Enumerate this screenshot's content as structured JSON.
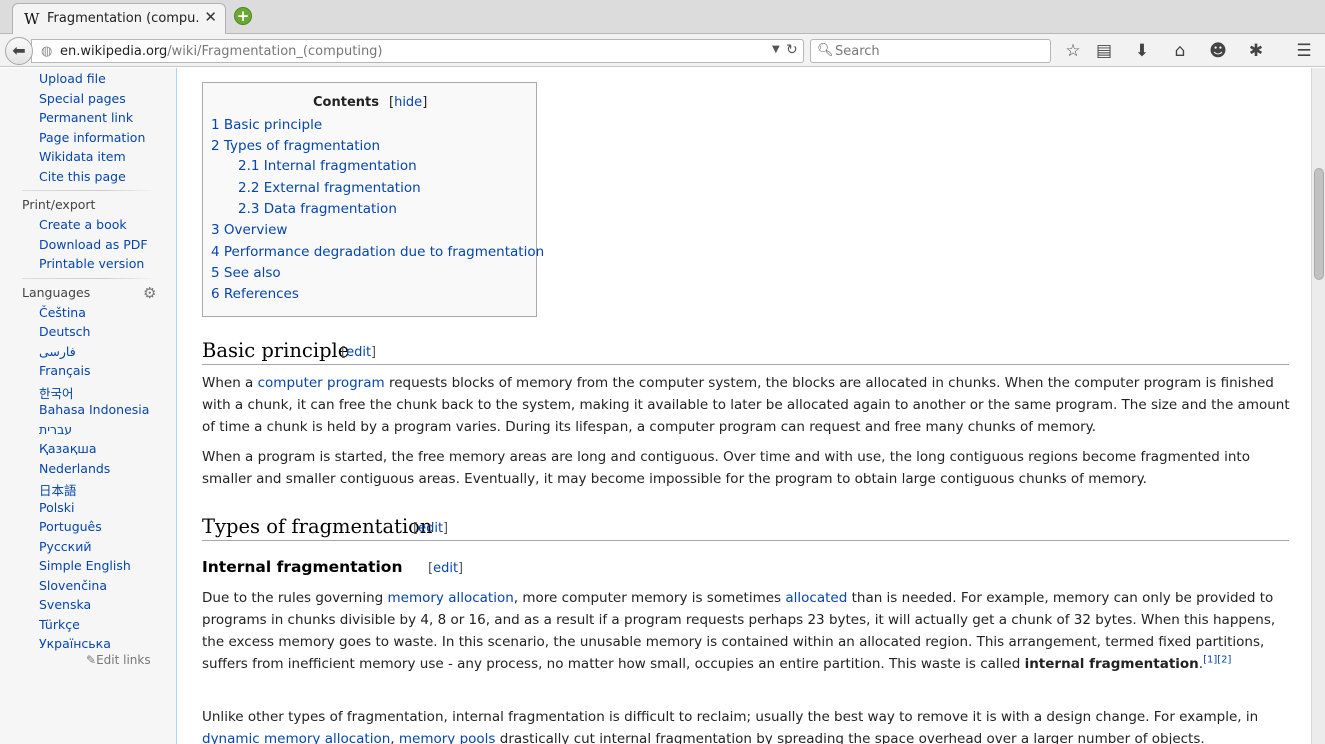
{
  "browser": {
    "tab_title": "Fragmentation (compu...",
    "tab_favicon": "W",
    "url_host": "en.wikipedia.org",
    "url_path": "/wiki/Fragmentation_(computing)",
    "search_placeholder": "Search"
  },
  "sidebar": {
    "tools": [
      "Upload file",
      "Special pages",
      "Permanent link",
      "Page information",
      "Wikidata item",
      "Cite this page"
    ],
    "print_heading": "Print/export",
    "print": [
      "Create a book",
      "Download as PDF",
      "Printable version"
    ],
    "languages_heading": "Languages",
    "languages": [
      "Čeština",
      "Deutsch",
      "فارسی",
      "Français",
      "한국어",
      "Bahasa Indonesia",
      "עברית",
      "Қазақша",
      "Nederlands",
      "日本語",
      "Polski",
      "Português",
      "Русский",
      "Simple English",
      "Slovenčina",
      "Svenska",
      "Türkçe",
      "Українська"
    ],
    "edit_links": "Edit links"
  },
  "toc": {
    "title": "Contents",
    "hide": "hide",
    "items": [
      "1 Basic principle",
      "2 Types of fragmentation",
      "2.1 Internal fragmentation",
      "2.2 External fragmentation",
      "2.3 Data fragmentation",
      "3 Overview",
      "4 Performance degradation due to fragmentation",
      "5 See also",
      "6 References"
    ]
  },
  "content": {
    "edit": "edit",
    "h_basic": "Basic principle",
    "p1": {
      "a": "When a ",
      "link": "computer program",
      "b": " requests blocks of memory from the computer system, the blocks are allocated in chunks. When the computer program is finished with a chunk, it can free the chunk back to the system, making it available to later be allocated again to another or the same program. The size and the amount of time a chunk is held by a program varies. During its lifespan, a computer program can request and free many chunks of memory."
    },
    "p2": "When a program is started, the free memory areas are long and contiguous. Over time and with use, the long contiguous regions become fragmented into smaller and smaller contiguous areas. Eventually, it may become impossible for the program to obtain large contiguous chunks of memory.",
    "h_types": "Types of fragmentation",
    "h_internal": "Internal fragmentation",
    "p3": {
      "a": "Due to the rules governing ",
      "link1": "memory allocation",
      "b": ", more computer memory is sometimes ",
      "link2": "allocated",
      "c": " than is needed. For example, memory can only be provided to programs in chunks divisible by 4, 8 or 16, and as a result if a program requests perhaps 23 bytes, it will actually get a chunk of 32 bytes. When this happens, the excess memory goes to waste. In this scenario, the unusable memory is contained within an allocated region. This arrangement, termed fixed partitions, suffers from inefficient memory use - any process, no matter how small, occupies an entire partition. This waste is called ",
      "bold": "internal fragmentation",
      "d": ".",
      "ref1": "[1]",
      "ref2": "[2]"
    },
    "p4": {
      "a": "Unlike other types of fragmentation, internal fragmentation is difficult to reclaim; usually the best way to remove it is with a design change. For example, in ",
      "link1": "dynamic memory allocation",
      "b": ", ",
      "link2": "memory pools",
      "c": " drastically cut internal fragmentation by spreading the space overhead over a larger number of objects."
    }
  }
}
